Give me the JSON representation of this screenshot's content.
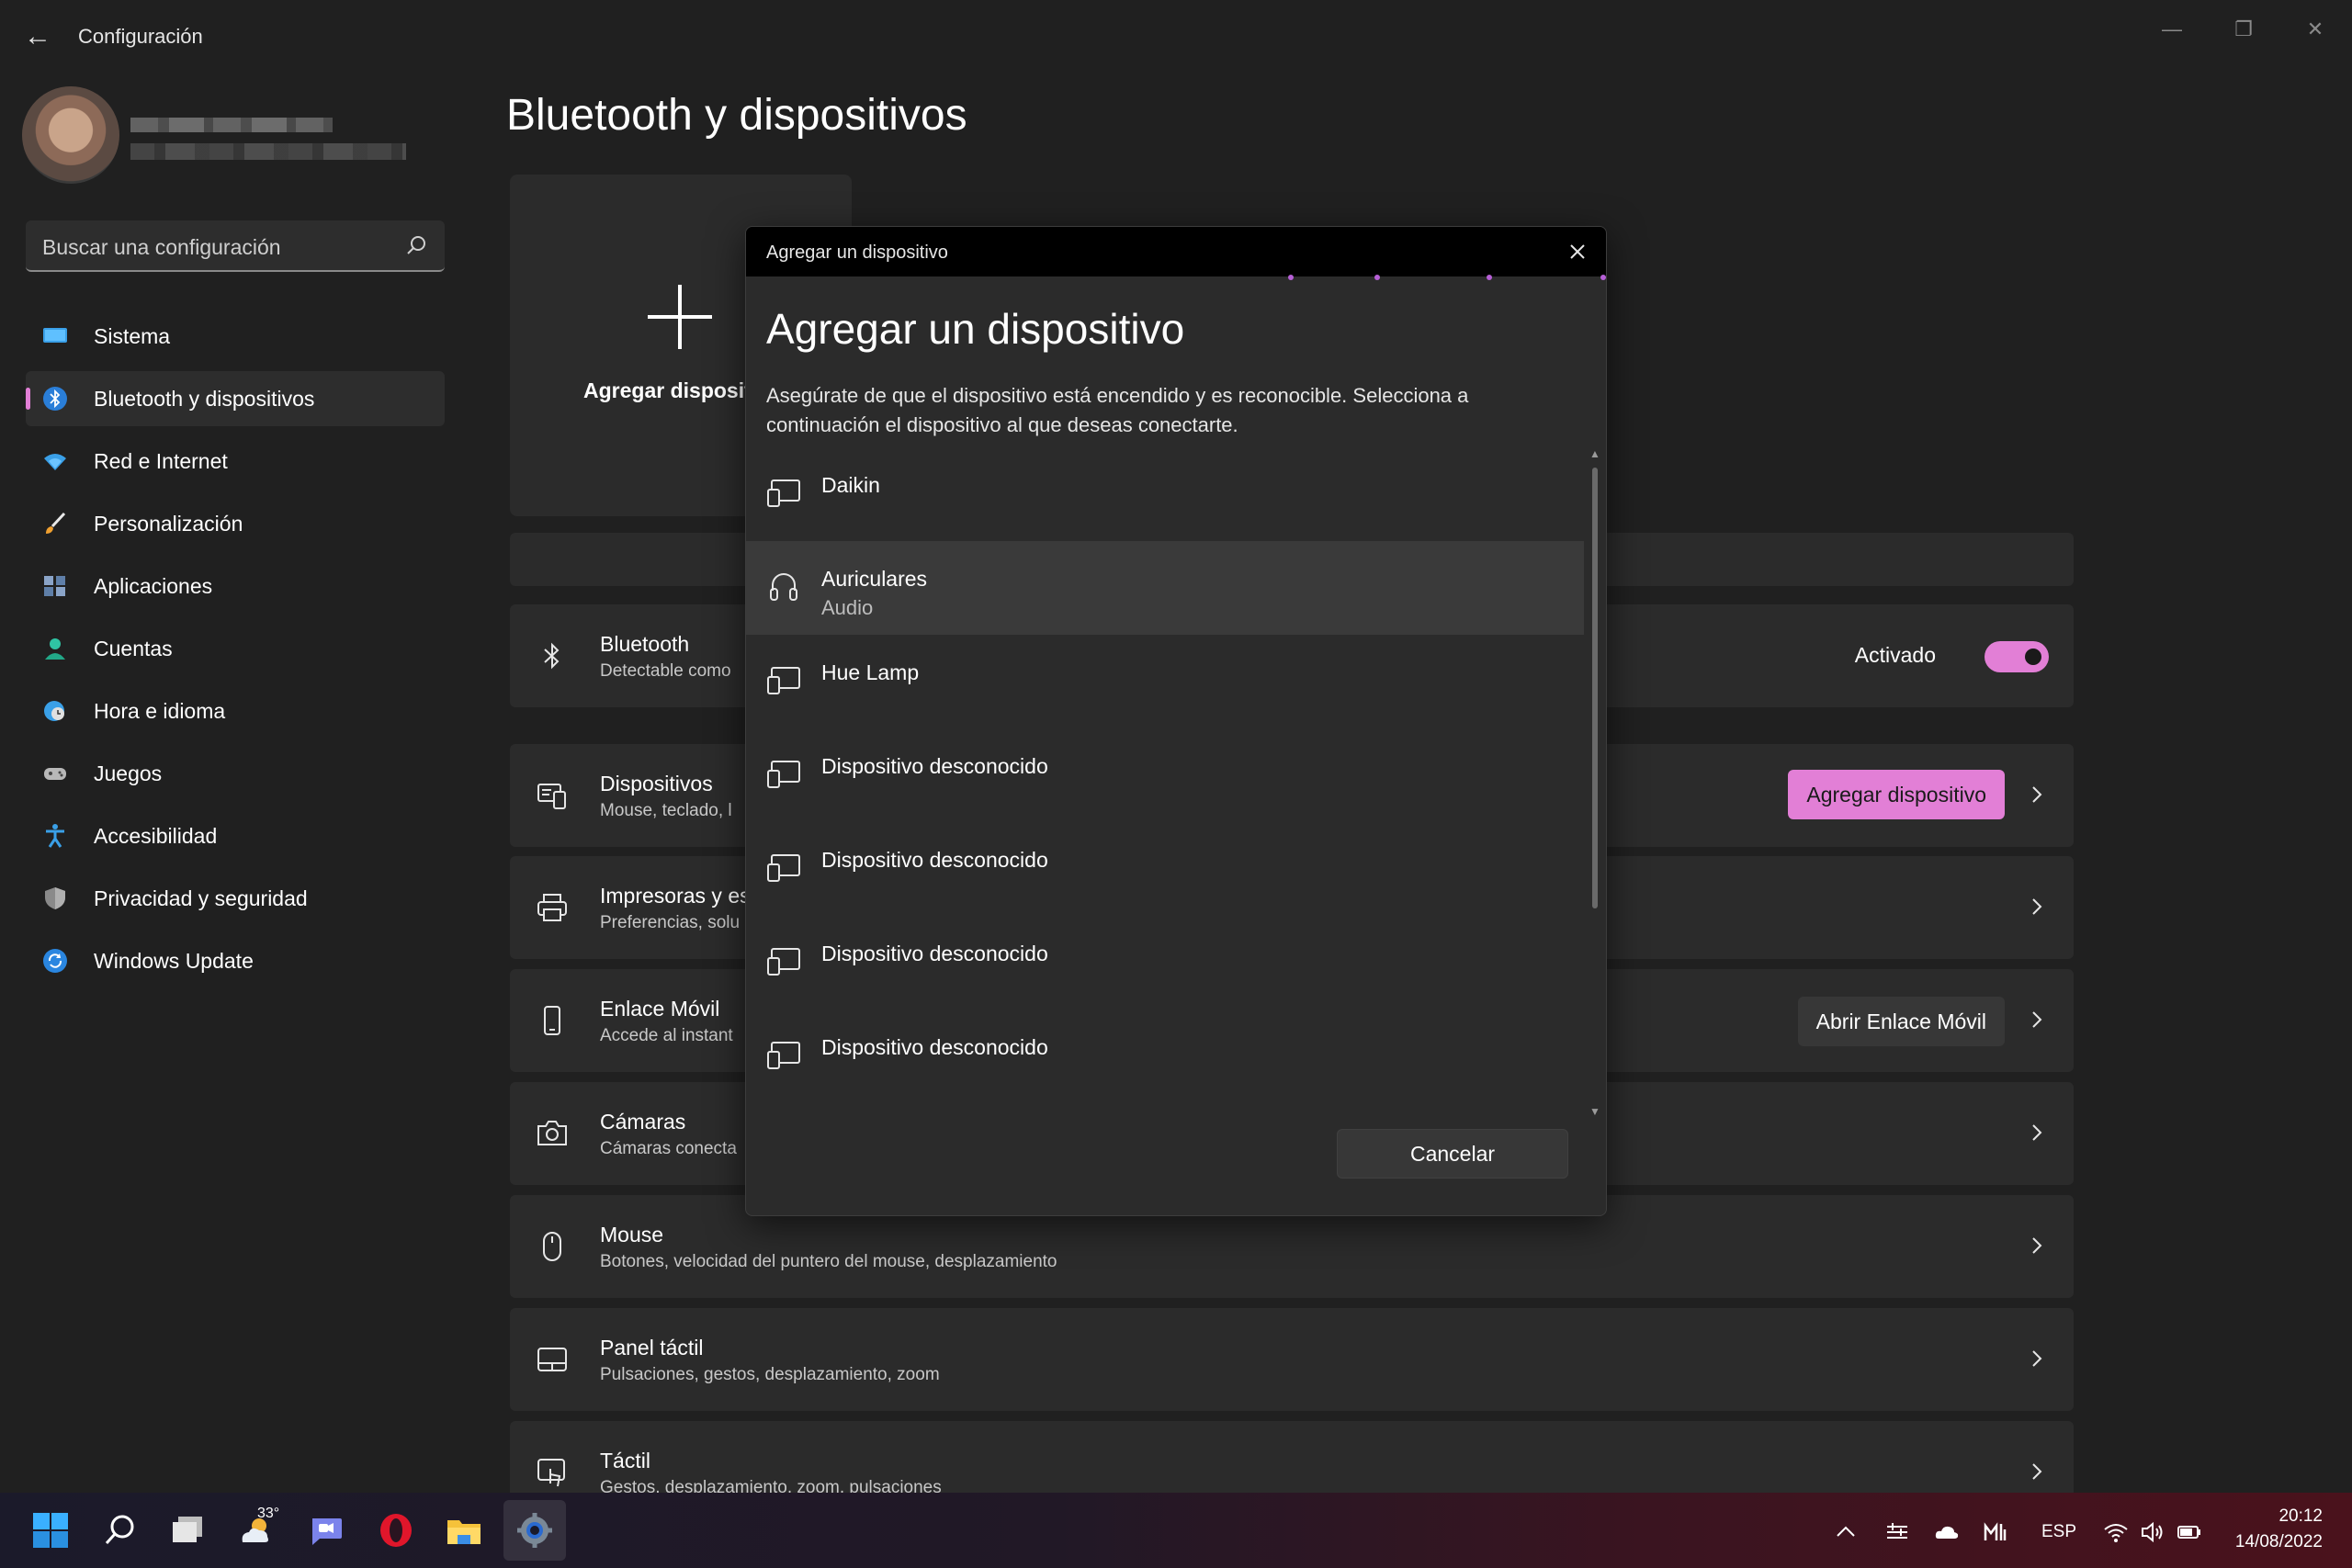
{
  "window": {
    "app_title": "Configuración",
    "back_icon": "arrow-left-icon",
    "controls": [
      "minimize-icon",
      "restore-icon",
      "close-icon"
    ]
  },
  "search": {
    "placeholder": "Buscar una configuración"
  },
  "sidebar": {
    "items": [
      {
        "label": "Sistema",
        "icon": "monitor-icon",
        "active": false
      },
      {
        "label": "Bluetooth y dispositivos",
        "icon": "bluetooth-icon",
        "active": true
      },
      {
        "label": "Red e Internet",
        "icon": "wifi-icon",
        "active": false
      },
      {
        "label": "Personalización",
        "icon": "brush-icon",
        "active": false
      },
      {
        "label": "Aplicaciones",
        "icon": "apps-icon",
        "active": false
      },
      {
        "label": "Cuentas",
        "icon": "person-icon",
        "active": false
      },
      {
        "label": "Hora e idioma",
        "icon": "globe-clock-icon",
        "active": false
      },
      {
        "label": "Juegos",
        "icon": "gamepad-icon",
        "active": false
      },
      {
        "label": "Accesibilidad",
        "icon": "accessibility-icon",
        "active": false
      },
      {
        "label": "Privacidad y seguridad",
        "icon": "shield-icon",
        "active": false
      },
      {
        "label": "Windows Update",
        "icon": "update-icon",
        "active": false
      }
    ]
  },
  "main": {
    "title": "Bluetooth y dispositivos",
    "add_tile_label": "Agregar disposit",
    "rows": [
      {
        "title": "Bluetooth",
        "subtitle": "Detectable como",
        "icon": "bluetooth-icon",
        "toggle_label": "Activado",
        "toggle_on": true
      },
      {
        "title": "Dispositivos",
        "subtitle": "Mouse, teclado, l",
        "icon": "devices-icon",
        "button": "Agregar dispositivo"
      },
      {
        "title": "Impresoras y es",
        "subtitle": "Preferencias, solu",
        "icon": "printer-icon"
      },
      {
        "title": "Enlace Móvil",
        "subtitle": "Accede al instant",
        "icon": "phone-icon",
        "button": "Abrir Enlace Móvil"
      },
      {
        "title": "Cámaras",
        "subtitle": "Cámaras conecta",
        "icon": "camera-icon"
      },
      {
        "title": "Mouse",
        "subtitle": "Botones, velocidad del puntero del mouse, desplazamiento",
        "icon": "mouse-icon"
      },
      {
        "title": "Panel táctil",
        "subtitle": "Pulsaciones, gestos, desplazamiento, zoom",
        "icon": "touchpad-icon"
      },
      {
        "title": "Táctil",
        "subtitle": "Gestos, desplazamiento, zoom, pulsaciones",
        "icon": "touch-icon"
      }
    ]
  },
  "dialog": {
    "window_title": "Agregar un dispositivo",
    "heading": "Agregar un dispositivo",
    "description": "Asegúrate de que el dispositivo está encendido y es reconocible. Selecciona a continuación el dispositivo al que deseas conectarte.",
    "devices": [
      {
        "name": "Daikin",
        "sub": "",
        "icon": "generic-device-icon",
        "selected": false
      },
      {
        "name": "Auriculares",
        "sub": "Audio",
        "icon": "headphones-icon",
        "selected": true
      },
      {
        "name": "Hue Lamp",
        "sub": "",
        "icon": "generic-device-icon",
        "selected": false
      },
      {
        "name": "Dispositivo desconocido",
        "sub": "",
        "icon": "generic-device-icon",
        "selected": false
      },
      {
        "name": "Dispositivo desconocido",
        "sub": "",
        "icon": "generic-device-icon",
        "selected": false
      },
      {
        "name": "Dispositivo desconocido",
        "sub": "",
        "icon": "generic-device-icon",
        "selected": false
      },
      {
        "name": "Dispositivo desconocido",
        "sub": "",
        "icon": "generic-device-icon",
        "selected": false
      }
    ],
    "cancel_label": "Cancelar"
  },
  "taskbar": {
    "apps": [
      "windows-start-icon",
      "search-icon",
      "task-view-icon",
      "weather-icon",
      "teams-chat-icon",
      "opera-icon",
      "file-explorer-icon",
      "settings-icon"
    ],
    "weather_temp": "33°",
    "tray": [
      "chevron-up-icon",
      "pen-settings-icon",
      "onedrive-cloud-icon",
      "app-tray-icon",
      "wifi-icon",
      "volume-icon",
      "battery-icon"
    ],
    "language": "ESP",
    "time": "20:12",
    "date": "14/08/2022"
  },
  "colors": {
    "accent": "#e27fd6",
    "background": "#202020",
    "card": "#2b2b2b"
  }
}
